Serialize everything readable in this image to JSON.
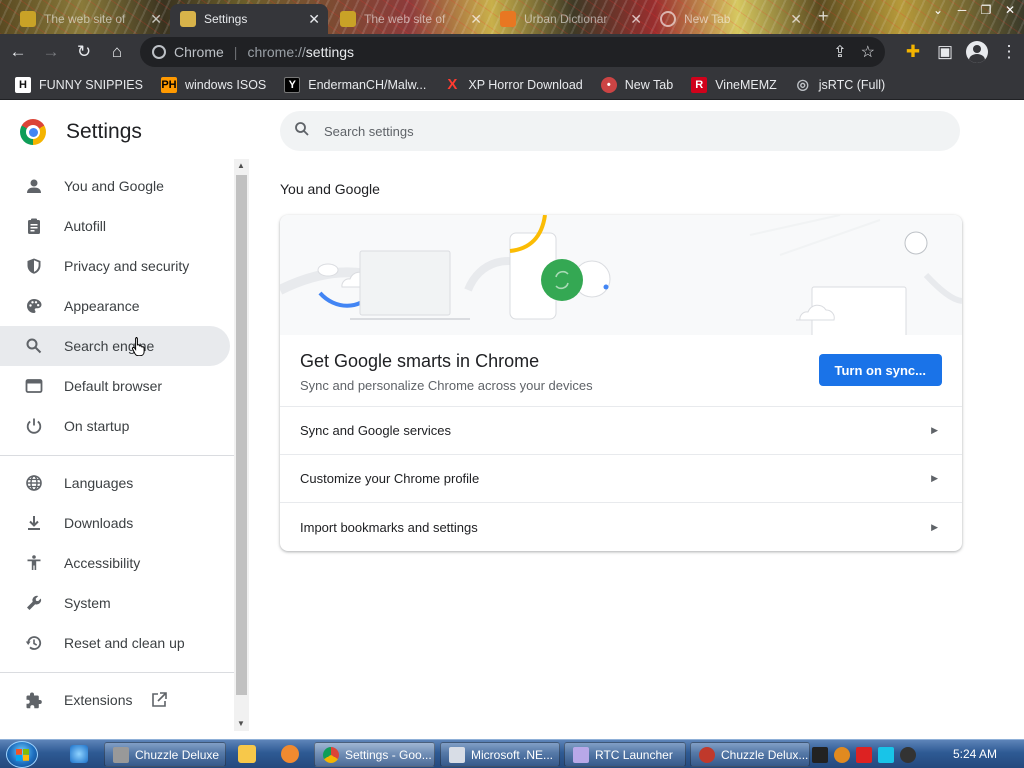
{
  "browser": {
    "tabs": [
      {
        "title": "The web site of",
        "active": false
      },
      {
        "title": "Settings",
        "active": true
      },
      {
        "title": "The web site of",
        "active": false
      },
      {
        "title": "Urban Dictionar",
        "active": false
      },
      {
        "title": "New Tab",
        "active": false
      }
    ],
    "omnibox": {
      "site_label": "Chrome",
      "url_scheme": "chrome://",
      "url_path": "settings"
    },
    "bookmarks": [
      {
        "label": "FUNNY SNIPPIES",
        "icon": "H"
      },
      {
        "label": "windows ISOS",
        "icon": "PH"
      },
      {
        "label": "EndermanCH/Malw...",
        "icon": "Y"
      },
      {
        "label": "XP Horror Download",
        "icon": "X"
      },
      {
        "label": "New Tab",
        "icon": "•"
      },
      {
        "label": "VineMEMZ",
        "icon": "R"
      },
      {
        "label": "jsRTC (Full)",
        "icon": "◎"
      }
    ]
  },
  "settings": {
    "title": "Settings",
    "search_placeholder": "Search settings",
    "nav": [
      {
        "label": "You and Google",
        "icon": "person-icon"
      },
      {
        "label": "Autofill",
        "icon": "clipboard-icon"
      },
      {
        "label": "Privacy and security",
        "icon": "shield-icon"
      },
      {
        "label": "Appearance",
        "icon": "palette-icon"
      },
      {
        "label": "Search engine",
        "icon": "search-icon"
      },
      {
        "label": "Default browser",
        "icon": "browser-icon"
      },
      {
        "label": "On startup",
        "icon": "power-icon"
      },
      {
        "label": "Languages",
        "icon": "globe-icon"
      },
      {
        "label": "Downloads",
        "icon": "download-icon"
      },
      {
        "label": "Accessibility",
        "icon": "accessibility-icon"
      },
      {
        "label": "System",
        "icon": "wrench-icon"
      },
      {
        "label": "Reset and clean up",
        "icon": "history-icon"
      },
      {
        "label": "Extensions",
        "icon": "puzzle-icon"
      }
    ],
    "section_title": "You and Google",
    "sync": {
      "title": "Get Google smarts in Chrome",
      "subtitle": "Sync and personalize Chrome across your devices",
      "button": "Turn on sync..."
    },
    "rows": [
      "Sync and Google services",
      "Customize your Chrome profile",
      "Import bookmarks and settings"
    ]
  },
  "taskbar": {
    "buttons": [
      {
        "label": "Chuzzle Deluxe"
      },
      {
        "label": "Settings - Goo..."
      },
      {
        "label": "Microsoft .NE..."
      },
      {
        "label": "RTC Launcher"
      },
      {
        "label": "Chuzzle Delux..."
      }
    ],
    "clock": "5:24 AM"
  },
  "colors": {
    "accent": "#1a73e8",
    "toolbar": "#35363a",
    "hover": "#e8eaed"
  }
}
